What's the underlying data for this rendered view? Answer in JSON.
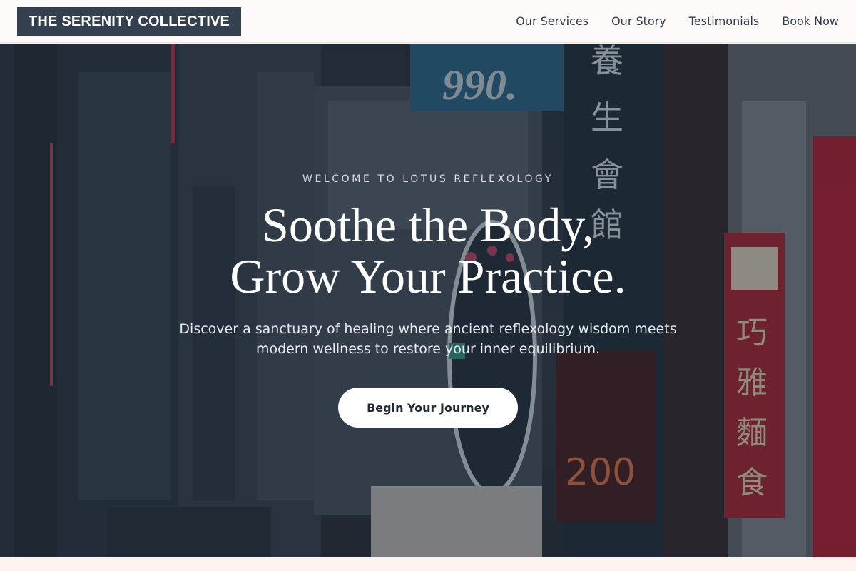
{
  "header": {
    "brand": "THE SERENITY COLLECTIVE",
    "nav": [
      {
        "label": "Our Services"
      },
      {
        "label": "Our Story"
      },
      {
        "label": "Testimonials"
      },
      {
        "label": "Book Now"
      }
    ]
  },
  "hero": {
    "eyebrow": "WELCOME TO LOTUS REFLEXOLOGY",
    "headline_line1": "Soothe the Body,",
    "headline_line2": "Grow Your Practice.",
    "subtext": "Discover a sanctuary of healing where ancient reflexology wisdom meets modern wellness to restore your inner equilibrium.",
    "cta_label": "Begin Your Journey",
    "background_description_icon": "neon-street-photo"
  },
  "colors": {
    "brand_bg": "#344050",
    "header_bg": "#fffafa",
    "cta_bg": "#ffffff",
    "page_bg": "#fdf2f0"
  }
}
